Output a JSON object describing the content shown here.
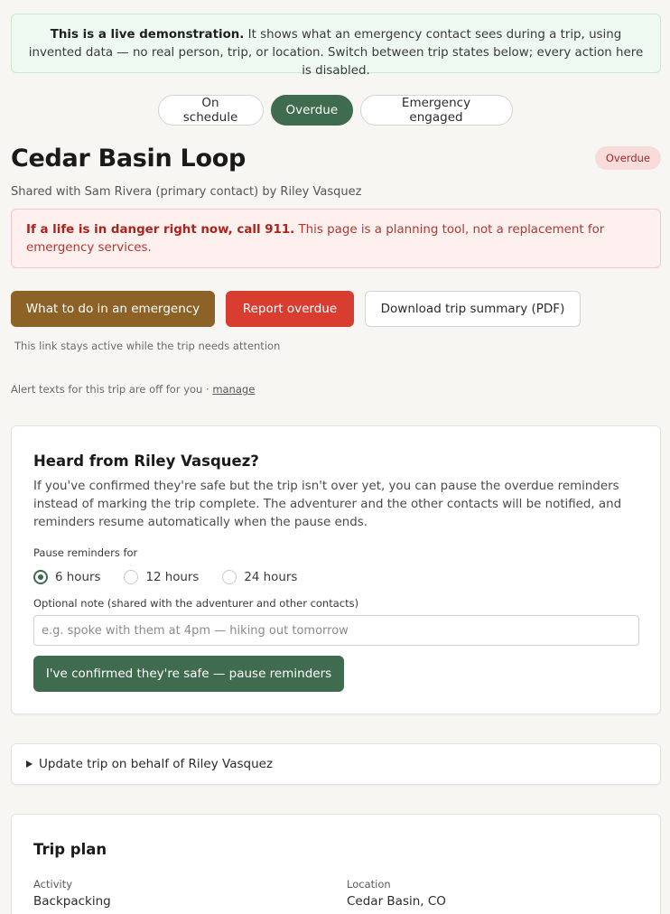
{
  "banner": {
    "strong": "This is a live demonstration.",
    "text": " It shows what an emergency contact sees during a trip, using invented data — no real person, trip, or location. Switch between trip states below; every action here is disabled."
  },
  "states": [
    "On schedule",
    "Overdue",
    "Emergency engaged"
  ],
  "trip": {
    "title": "Cedar Basin Loop",
    "status": "Overdue",
    "shared": "Shared with Sam Rivera (primary contact) by Riley Vasquez"
  },
  "danger": {
    "strong": "If a life is in danger right now, call 911.",
    "text": " This page is a planning tool, not a replacement for emergency services."
  },
  "actions": {
    "emergency": "What to do in an emergency",
    "overdue": "Report overdue",
    "pdf": "Download trip summary (PDF)"
  },
  "link_note": "This link stays active while the trip needs attention",
  "alerts": {
    "text": "Alert texts for this trip are off for you · ",
    "manage": "manage"
  },
  "heard": {
    "title": "Heard from Riley Vasquez?",
    "desc": "If you've confirmed they're safe but the trip isn't over yet, you can pause the overdue reminders instead of marking the trip complete. The adventurer and the other contacts will be notified, and reminders resume automatically when the pause ends.",
    "pause_label": "Pause reminders for",
    "options": [
      "6 hours",
      "12 hours",
      "24 hours"
    ],
    "selected": "6 hours",
    "note_label": "Optional note (shared with the adventurer and other contacts)",
    "note_placeholder": "e.g. spoke with them at 4pm — hiking out tomorrow",
    "confirm": "I've confirmed they're safe — pause reminders"
  },
  "update": {
    "summary": "Update trip on behalf of Riley Vasquez"
  },
  "plan": {
    "title": "Trip plan",
    "activity_label": "Activity",
    "activity": "Backpacking",
    "location_label": "Location",
    "location": "Cedar Basin, CO"
  },
  "colors": {
    "primary_green": "#3f6b4e",
    "emergency_brown": "#8c6226",
    "overdue_red": "#d83d30",
    "banner_bg": "#eefaf1",
    "danger_bg": "#fdf0ef"
  }
}
